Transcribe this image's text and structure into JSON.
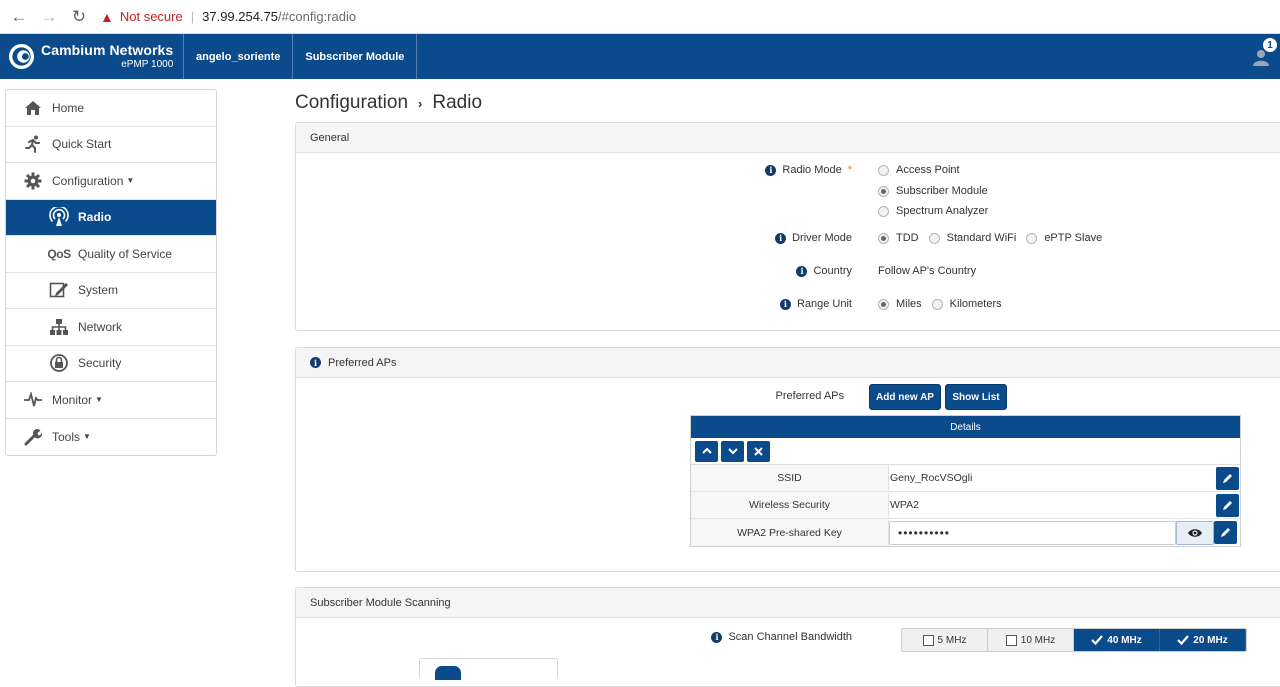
{
  "browser": {
    "not_secure": "Not secure",
    "url_host": "37.99.254.75",
    "url_path": "/#config:radio"
  },
  "header": {
    "brand_name": "Cambium Networks",
    "brand_model": "ePMP 1000",
    "username": "angelo_soriente",
    "device_mode": "Subscriber Module",
    "notification_count": "1"
  },
  "sidebar": {
    "items": [
      {
        "label": "Home",
        "icon": "home-icon"
      },
      {
        "label": "Quick Start",
        "icon": "running-person-icon"
      },
      {
        "label": "Configuration",
        "icon": "gear-icon"
      },
      {
        "label": "Radio",
        "icon": "radio-signal-icon"
      },
      {
        "label": "Quality of Service",
        "icon": "qos-icon"
      },
      {
        "label": "System",
        "icon": "system-edit-icon"
      },
      {
        "label": "Network",
        "icon": "network-icon"
      },
      {
        "label": "Security",
        "icon": "security-lock-icon"
      },
      {
        "label": "Monitor",
        "icon": "pulse-icon"
      },
      {
        "label": "Tools",
        "icon": "wrench-icon"
      }
    ],
    "qos_glyph": "QoS"
  },
  "breadcrumb": {
    "parent": "Configuration",
    "current": "Radio"
  },
  "general": {
    "title": "General",
    "radio_mode": {
      "label": "Radio Mode",
      "required_mark": "*",
      "options": [
        "Access Point",
        "Subscriber Module",
        "Spectrum Analyzer"
      ],
      "selected": "Subscriber Module"
    },
    "driver_mode": {
      "label": "Driver Mode",
      "options": [
        "TDD",
        "Standard WiFi",
        "ePTP Slave"
      ],
      "selected": "TDD"
    },
    "country": {
      "label": "Country",
      "value": "Follow AP's Country"
    },
    "range_unit": {
      "label": "Range Unit",
      "options": [
        "Miles",
        "Kilometers"
      ],
      "selected": "Miles"
    }
  },
  "preferred_aps": {
    "title": "Preferred APs",
    "label": "Preferred APs",
    "add_button": "Add new AP",
    "show_button": "Show List",
    "details_title": "Details",
    "rows": [
      {
        "key": "SSID",
        "value": "Geny_RocVSOgli"
      },
      {
        "key": "Wireless Security",
        "value": "WPA2"
      },
      {
        "key": "WPA2 Pre-shared Key",
        "value": "••••••••••"
      }
    ]
  },
  "scanning": {
    "title": "Subscriber Module Scanning",
    "bandwidth_label": "Scan Channel Bandwidth",
    "options": [
      {
        "label": "5 MHz",
        "checked": false
      },
      {
        "label": "10 MHz",
        "checked": false
      },
      {
        "label": "40 MHz",
        "checked": true
      },
      {
        "label": "20 MHz",
        "checked": true
      }
    ]
  },
  "colors": {
    "brand_blue": "#0b4a8b",
    "warning_red": "#c5221f",
    "required_orange": "#e08a00"
  }
}
